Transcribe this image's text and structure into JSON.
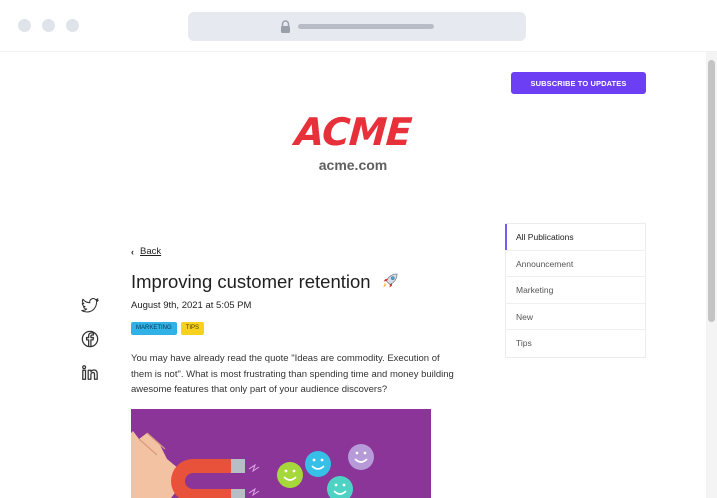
{
  "header": {
    "subscribe_label": "SUBSCRIBE TO UPDATES"
  },
  "brand": {
    "logo_text": "ACME",
    "domain": "acme.com",
    "logo_color": "#e8303a"
  },
  "article": {
    "back_label": "Back",
    "title": "Improving customer retention",
    "date": "August 9th, 2021 at 5:05 PM",
    "tags": [
      "MARKETING",
      "TIPS"
    ],
    "excerpt": "You may have already read the quote \"Ideas are commodity. Execution of them is not\". What is most frustrating than spending time and money building awesome features that only part of your audience discovers?"
  },
  "social": {
    "icons": [
      "twitter-icon",
      "facebook-icon",
      "linkedin-icon"
    ]
  },
  "publications": {
    "items": [
      "All Publications",
      "Announcement",
      "Marketing",
      "New",
      "Tips"
    ],
    "active_index": 0
  },
  "colors": {
    "accent": "#6c3ff5",
    "marketing_tag": "#31b2e6",
    "tips_tag": "#f6d21e",
    "hero_bg": "#8b3598"
  }
}
